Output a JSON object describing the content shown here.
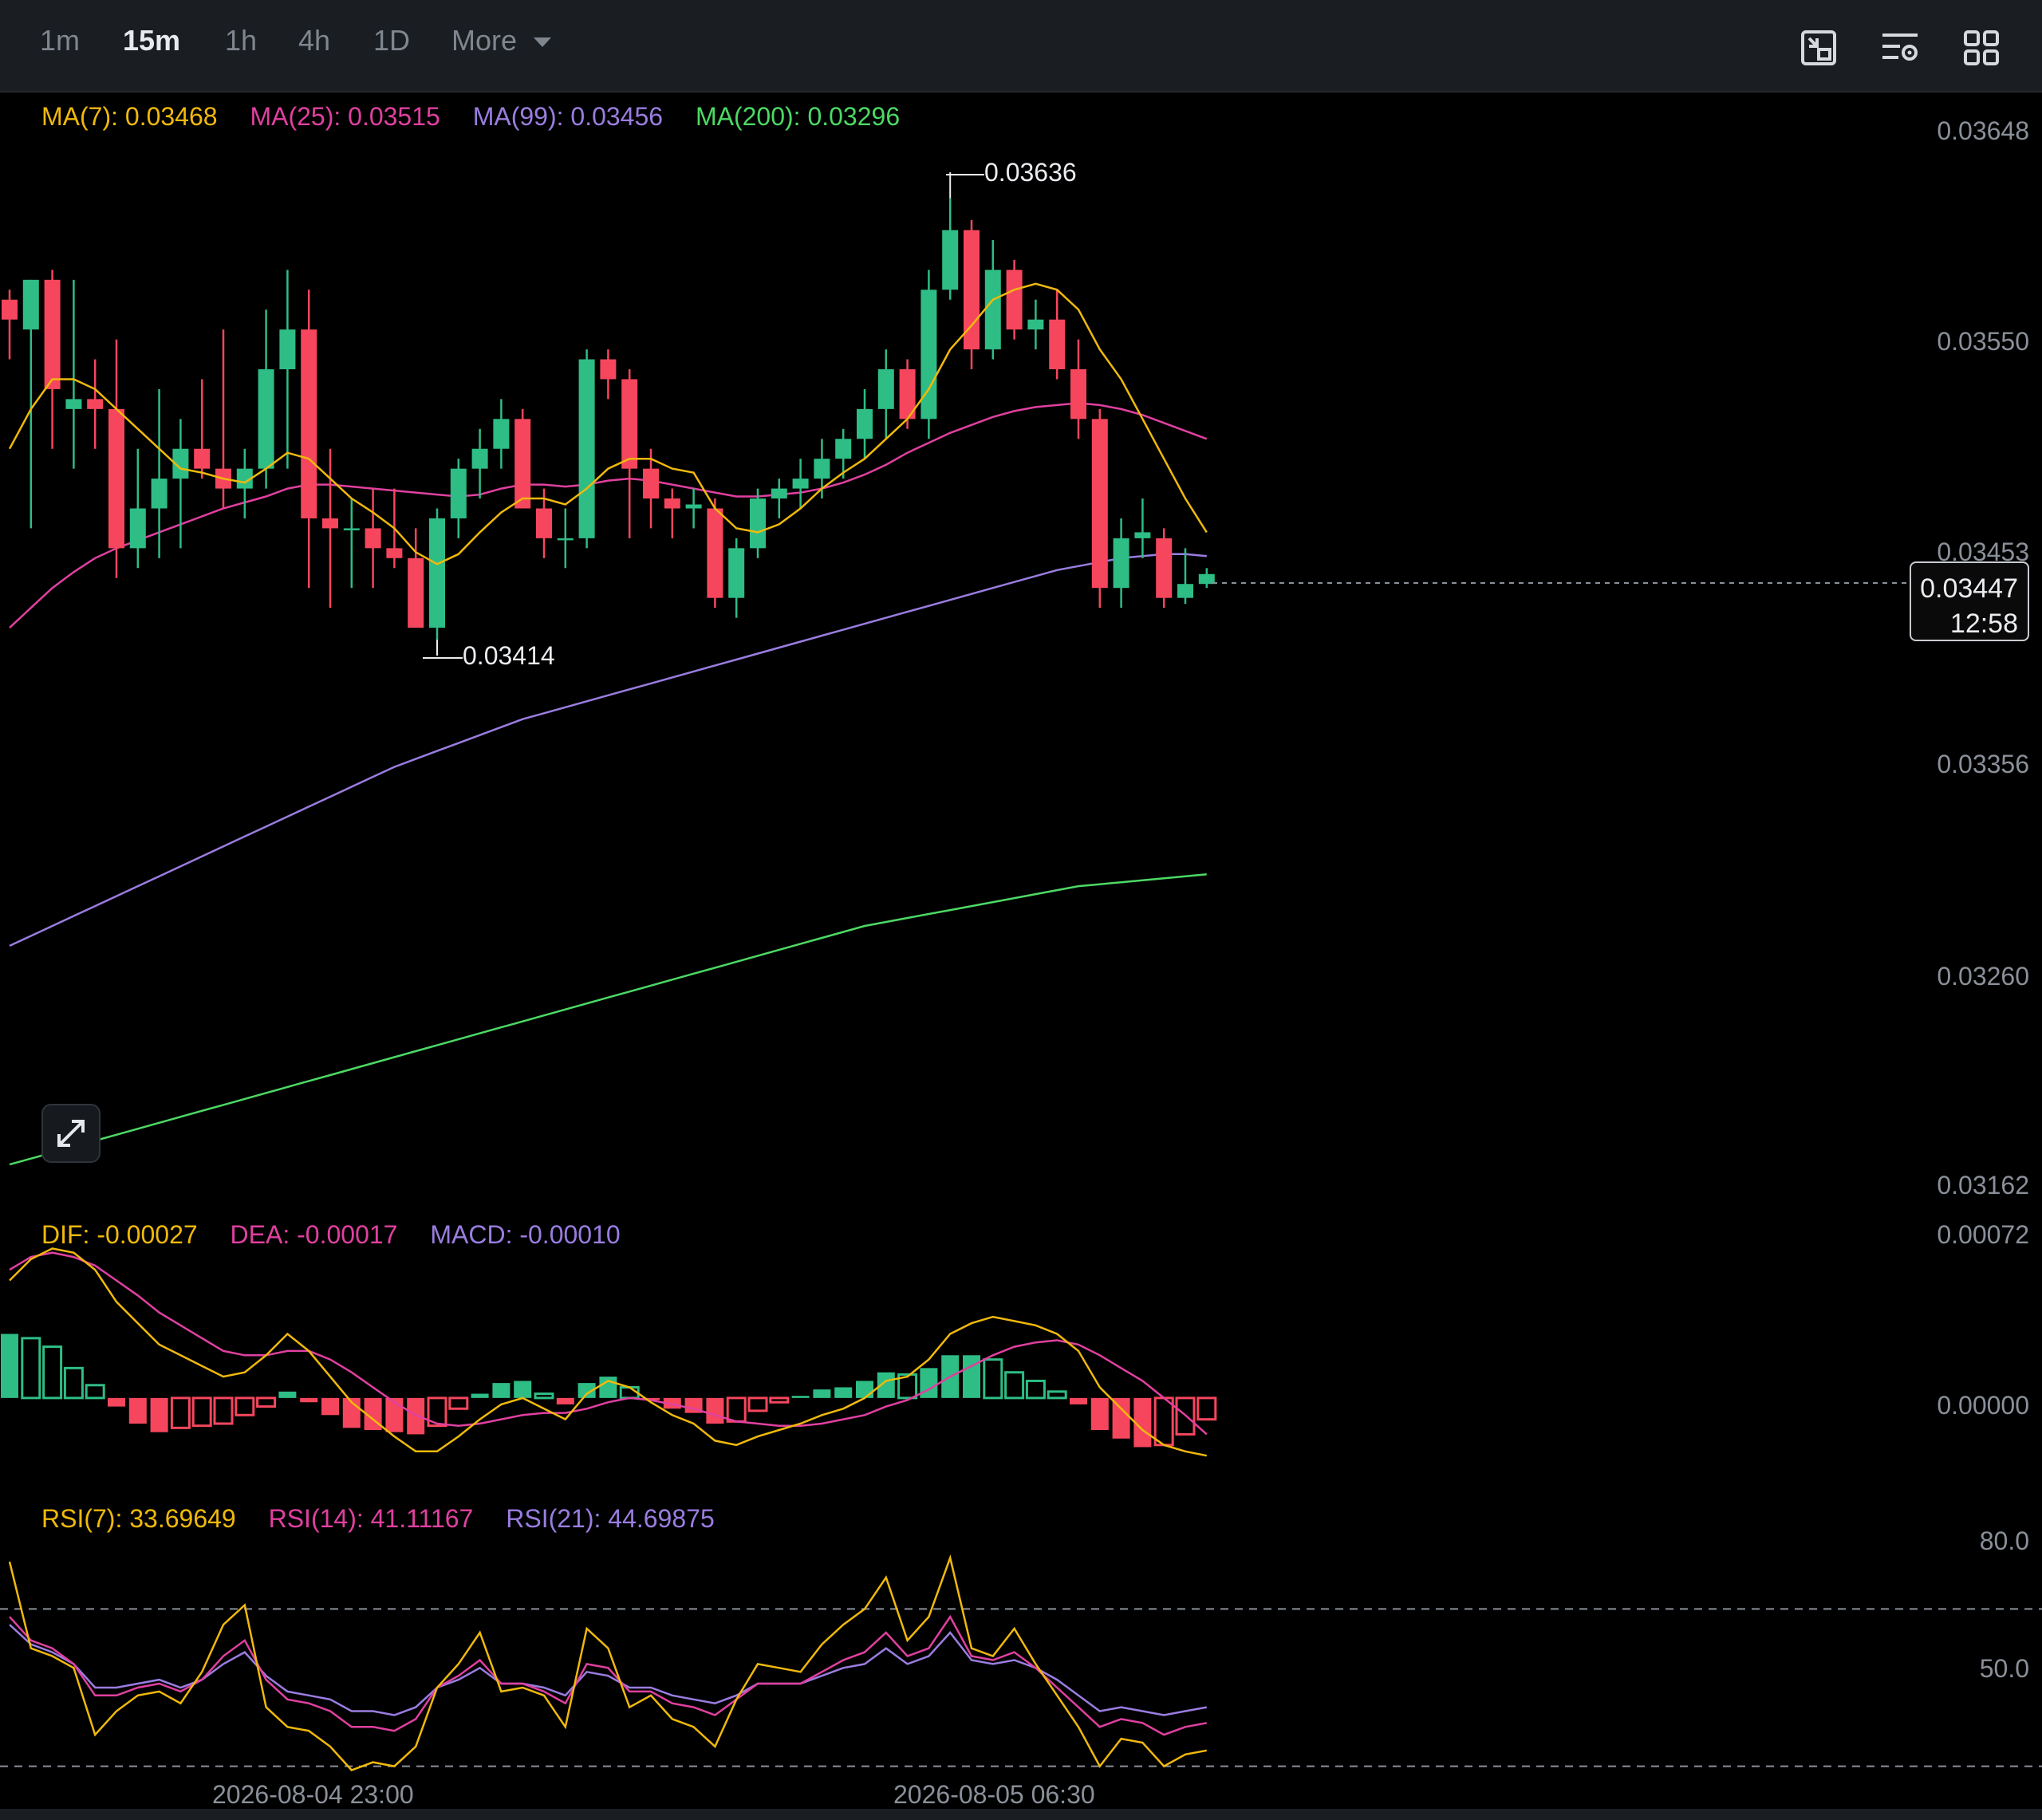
{
  "toolbar": {
    "tabs": [
      {
        "label": "1m",
        "active": false
      },
      {
        "label": "15m",
        "active": true
      },
      {
        "label": "1h",
        "active": false
      },
      {
        "label": "4h",
        "active": false
      },
      {
        "label": "1D",
        "active": false
      },
      {
        "label": "More",
        "active": false
      }
    ],
    "icons": [
      "chart-layout-icon",
      "indicator-settings-icon",
      "grid-icon"
    ]
  },
  "legends": {
    "ma": [
      {
        "label": "MA(7): 0.03468",
        "color": "#f0b90b"
      },
      {
        "label": "MA(25): 0.03515",
        "color": "#e040a0"
      },
      {
        "label": "MA(99): 0.03456",
        "color": "#9a7de0"
      },
      {
        "label": "MA(200): 0.03296",
        "color": "#4cd964"
      }
    ],
    "macd": [
      {
        "label": "DIF: -0.00027",
        "color": "#f0b90b"
      },
      {
        "label": "DEA: -0.00017",
        "color": "#e040a0"
      },
      {
        "label": "MACD: -0.00010",
        "color": "#9a7de0"
      }
    ],
    "rsi": [
      {
        "label": "RSI(7): 33.69649",
        "color": "#f0b90b"
      },
      {
        "label": "RSI(14): 41.11167",
        "color": "#e040a0"
      },
      {
        "label": "RSI(21): 44.69875",
        "color": "#9a7de0"
      }
    ]
  },
  "price_axis": [
    "0.03648",
    "0.03550",
    "0.03453",
    "0.03356",
    "0.03260",
    "0.03162"
  ],
  "macd_axis": [
    "0.00072",
    "0.00000"
  ],
  "rsi_axis": [
    "80.0",
    "50.0"
  ],
  "current_price": {
    "value": "0.03447",
    "countdown": "12:58"
  },
  "annotations": {
    "high": "0.03636",
    "low": "0.03414"
  },
  "time_labels": [
    "2026-08-04 23:00",
    "2026-08-05 06:30"
  ],
  "colors": {
    "up": "#2ebd85",
    "down": "#f6465d",
    "ma7": "#f0b90b",
    "ma25": "#e040a0",
    "ma99": "#9a7de0",
    "ma200": "#4cd964"
  },
  "chart_data": {
    "type": "candlestick",
    "interval": "15m",
    "ylim": [
      0.0313,
      0.0369
    ],
    "candles": [
      {
        "o": 0.03585,
        "h": 0.0359,
        "l": 0.03555,
        "c": 0.03575
      },
      {
        "o": 0.0357,
        "h": 0.03595,
        "l": 0.0347,
        "c": 0.03595
      },
      {
        "o": 0.03595,
        "h": 0.036,
        "l": 0.0351,
        "c": 0.0354
      },
      {
        "o": 0.0353,
        "h": 0.03595,
        "l": 0.035,
        "c": 0.03535
      },
      {
        "o": 0.03535,
        "h": 0.03555,
        "l": 0.0351,
        "c": 0.0353
      },
      {
        "o": 0.0353,
        "h": 0.03565,
        "l": 0.03445,
        "c": 0.0346
      },
      {
        "o": 0.0346,
        "h": 0.0351,
        "l": 0.0345,
        "c": 0.0348
      },
      {
        "o": 0.0348,
        "h": 0.0354,
        "l": 0.03455,
        "c": 0.03495
      },
      {
        "o": 0.03495,
        "h": 0.03525,
        "l": 0.0346,
        "c": 0.0351
      },
      {
        "o": 0.0351,
        "h": 0.03545,
        "l": 0.03495,
        "c": 0.035
      },
      {
        "o": 0.035,
        "h": 0.0357,
        "l": 0.0348,
        "c": 0.0349
      },
      {
        "o": 0.0349,
        "h": 0.0351,
        "l": 0.03475,
        "c": 0.035
      },
      {
        "o": 0.035,
        "h": 0.0358,
        "l": 0.0349,
        "c": 0.0355
      },
      {
        "o": 0.0355,
        "h": 0.036,
        "l": 0.035,
        "c": 0.0357
      },
      {
        "o": 0.0357,
        "h": 0.0359,
        "l": 0.0344,
        "c": 0.03475
      },
      {
        "o": 0.03475,
        "h": 0.0351,
        "l": 0.0343,
        "c": 0.0347
      },
      {
        "o": 0.0347,
        "h": 0.03485,
        "l": 0.0344,
        "c": 0.0347
      },
      {
        "o": 0.0347,
        "h": 0.0349,
        "l": 0.0344,
        "c": 0.0346
      },
      {
        "o": 0.0346,
        "h": 0.0349,
        "l": 0.0345,
        "c": 0.03455
      },
      {
        "o": 0.03455,
        "h": 0.0347,
        "l": 0.0342,
        "c": 0.0342
      },
      {
        "o": 0.0342,
        "h": 0.0348,
        "l": 0.03414,
        "c": 0.03475
      },
      {
        "o": 0.03475,
        "h": 0.03505,
        "l": 0.03465,
        "c": 0.035
      },
      {
        "o": 0.035,
        "h": 0.0352,
        "l": 0.03485,
        "c": 0.0351
      },
      {
        "o": 0.0351,
        "h": 0.03535,
        "l": 0.035,
        "c": 0.03525
      },
      {
        "o": 0.03525,
        "h": 0.0353,
        "l": 0.0348,
        "c": 0.0348
      },
      {
        "o": 0.0348,
        "h": 0.0349,
        "l": 0.03455,
        "c": 0.03465
      },
      {
        "o": 0.03465,
        "h": 0.0348,
        "l": 0.0345,
        "c": 0.03465
      },
      {
        "o": 0.03465,
        "h": 0.0356,
        "l": 0.0346,
        "c": 0.03555
      },
      {
        "o": 0.03555,
        "h": 0.0356,
        "l": 0.03535,
        "c": 0.03545
      },
      {
        "o": 0.03545,
        "h": 0.0355,
        "l": 0.03465,
        "c": 0.035
      },
      {
        "o": 0.035,
        "h": 0.0351,
        "l": 0.0347,
        "c": 0.03485
      },
      {
        "o": 0.03485,
        "h": 0.0349,
        "l": 0.03465,
        "c": 0.0348
      },
      {
        "o": 0.0348,
        "h": 0.0349,
        "l": 0.0347,
        "c": 0.03482
      },
      {
        "o": 0.0348,
        "h": 0.03485,
        "l": 0.0343,
        "c": 0.03435
      },
      {
        "o": 0.03435,
        "h": 0.03465,
        "l": 0.03425,
        "c": 0.0346
      },
      {
        "o": 0.0346,
        "h": 0.0349,
        "l": 0.03455,
        "c": 0.03485
      },
      {
        "o": 0.03485,
        "h": 0.03495,
        "l": 0.03475,
        "c": 0.0349
      },
      {
        "o": 0.0349,
        "h": 0.03505,
        "l": 0.0348,
        "c": 0.03495
      },
      {
        "o": 0.03495,
        "h": 0.03515,
        "l": 0.03485,
        "c": 0.03505
      },
      {
        "o": 0.03505,
        "h": 0.0352,
        "l": 0.03495,
        "c": 0.03515
      },
      {
        "o": 0.03515,
        "h": 0.0354,
        "l": 0.03505,
        "c": 0.0353
      },
      {
        "o": 0.0353,
        "h": 0.0356,
        "l": 0.03515,
        "c": 0.0355
      },
      {
        "o": 0.0355,
        "h": 0.03555,
        "l": 0.0352,
        "c": 0.03525
      },
      {
        "o": 0.03525,
        "h": 0.036,
        "l": 0.03515,
        "c": 0.0359
      },
      {
        "o": 0.0359,
        "h": 0.03636,
        "l": 0.03585,
        "c": 0.0362
      },
      {
        "o": 0.0362,
        "h": 0.03625,
        "l": 0.0355,
        "c": 0.0356
      },
      {
        "o": 0.0356,
        "h": 0.03615,
        "l": 0.03555,
        "c": 0.036
      },
      {
        "o": 0.036,
        "h": 0.03605,
        "l": 0.03565,
        "c": 0.0357
      },
      {
        "o": 0.0357,
        "h": 0.03585,
        "l": 0.0356,
        "c": 0.03575
      },
      {
        "o": 0.03575,
        "h": 0.0359,
        "l": 0.03545,
        "c": 0.0355
      },
      {
        "o": 0.0355,
        "h": 0.03565,
        "l": 0.03515,
        "c": 0.03525
      },
      {
        "o": 0.03525,
        "h": 0.0353,
        "l": 0.0343,
        "c": 0.0344
      },
      {
        "o": 0.0344,
        "h": 0.03475,
        "l": 0.0343,
        "c": 0.03465
      },
      {
        "o": 0.03465,
        "h": 0.03485,
        "l": 0.03455,
        "c": 0.03468
      },
      {
        "o": 0.03465,
        "h": 0.0347,
        "l": 0.0343,
        "c": 0.03435
      },
      {
        "o": 0.03435,
        "h": 0.0346,
        "l": 0.03432,
        "c": 0.03442
      },
      {
        "o": 0.03442,
        "h": 0.0345,
        "l": 0.0344,
        "c": 0.03447
      }
    ],
    "ma7": [
      0.0351,
      0.0353,
      0.03545,
      0.03545,
      0.0354,
      0.0353,
      0.0352,
      0.0351,
      0.035,
      0.03498,
      0.03495,
      0.03493,
      0.035,
      0.03508,
      0.03505,
      0.03495,
      0.03485,
      0.03478,
      0.0347,
      0.03458,
      0.03452,
      0.03457,
      0.03468,
      0.03478,
      0.03485,
      0.03485,
      0.03482,
      0.0349,
      0.035,
      0.03505,
      0.03505,
      0.035,
      0.03498,
      0.0348,
      0.0347,
      0.03468,
      0.03472,
      0.0348,
      0.0349,
      0.03498,
      0.03505,
      0.03515,
      0.03525,
      0.0354,
      0.0356,
      0.03572,
      0.03585,
      0.0359,
      0.03593,
      0.0359,
      0.0358,
      0.0356,
      0.03545,
      0.03525,
      0.03505,
      0.03485,
      0.03468
    ],
    "ma25": [
      0.0342,
      0.0343,
      0.0344,
      0.03448,
      0.03455,
      0.0346,
      0.03464,
      0.03468,
      0.03472,
      0.03476,
      0.0348,
      0.03483,
      0.03486,
      0.0349,
      0.03492,
      0.03492,
      0.03491,
      0.0349,
      0.03489,
      0.03488,
      0.03487,
      0.03486,
      0.03487,
      0.0349,
      0.03492,
      0.03492,
      0.03491,
      0.03492,
      0.03494,
      0.03495,
      0.03494,
      0.03492,
      0.0349,
      0.03488,
      0.03486,
      0.03486,
      0.03487,
      0.03488,
      0.0349,
      0.03493,
      0.03497,
      0.03502,
      0.03508,
      0.03513,
      0.03518,
      0.03522,
      0.03526,
      0.03529,
      0.03531,
      0.03532,
      0.03533,
      0.03532,
      0.0353,
      0.03527,
      0.03523,
      0.03519,
      0.03515
    ],
    "ma99": [
      0.0326,
      0.03265,
      0.0327,
      0.03275,
      0.0328,
      0.03285,
      0.0329,
      0.03295,
      0.033,
      0.03305,
      0.0331,
      0.03315,
      0.0332,
      0.03325,
      0.0333,
      0.03335,
      0.0334,
      0.03345,
      0.0335,
      0.03354,
      0.03358,
      0.03362,
      0.03366,
      0.0337,
      0.03374,
      0.03377,
      0.0338,
      0.03383,
      0.03386,
      0.03389,
      0.03392,
      0.03395,
      0.03398,
      0.03401,
      0.03404,
      0.03407,
      0.0341,
      0.03413,
      0.03416,
      0.03419,
      0.03422,
      0.03425,
      0.03428,
      0.03431,
      0.03434,
      0.03437,
      0.0344,
      0.03443,
      0.03446,
      0.03449,
      0.03451,
      0.03453,
      0.03455,
      0.03456,
      0.03457,
      0.03457,
      0.03456
    ],
    "ma200": [
      0.0315,
      0.03153,
      0.03156,
      0.03159,
      0.03162,
      0.03165,
      0.03168,
      0.03171,
      0.03174,
      0.03177,
      0.0318,
      0.03183,
      0.03186,
      0.03189,
      0.03192,
      0.03195,
      0.03198,
      0.03201,
      0.03204,
      0.03207,
      0.0321,
      0.03213,
      0.03216,
      0.03219,
      0.03222,
      0.03225,
      0.03228,
      0.03231,
      0.03234,
      0.03237,
      0.0324,
      0.03243,
      0.03246,
      0.03249,
      0.03252,
      0.03255,
      0.03258,
      0.03261,
      0.03264,
      0.03267,
      0.0327,
      0.03272,
      0.03274,
      0.03276,
      0.03278,
      0.0328,
      0.03282,
      0.03284,
      0.03286,
      0.03288,
      0.0329,
      0.03291,
      0.03292,
      0.03293,
      0.03294,
      0.03295,
      0.03296
    ],
    "macd_ylim": [
      -0.0004,
      0.00072
    ],
    "dif": [
      0.00055,
      0.00065,
      0.0007,
      0.00068,
      0.0006,
      0.00045,
      0.00035,
      0.00025,
      0.0002,
      0.00015,
      0.0001,
      0.00012,
      0.0002,
      0.0003,
      0.00022,
      0.0001,
      -2e-05,
      -0.0001,
      -0.00018,
      -0.00025,
      -0.00025,
      -0.00018,
      -0.0001,
      -3e-05,
      0.0,
      -5e-05,
      -0.0001,
      2e-05,
      8e-05,
      5e-05,
      -2e-05,
      -8e-05,
      -0.00012,
      -0.0002,
      -0.00022,
      -0.00018,
      -0.00015,
      -0.00012,
      -8e-05,
      -5e-05,
      0.0,
      8e-05,
      0.0001,
      0.00018,
      0.0003,
      0.00035,
      0.00038,
      0.00036,
      0.00034,
      0.0003,
      0.00022,
      5e-05,
      -5e-05,
      -0.00015,
      -0.00022,
      -0.00025,
      -0.00027
    ],
    "dea": [
      0.0006,
      0.00066,
      0.00068,
      0.00066,
      0.00062,
      0.00055,
      0.00048,
      0.0004,
      0.00034,
      0.00028,
      0.00022,
      0.0002,
      0.0002,
      0.00022,
      0.00022,
      0.00018,
      0.00012,
      5e-05,
      -2e-05,
      -8e-05,
      -0.00012,
      -0.00013,
      -0.00012,
      -0.0001,
      -8e-05,
      -7e-05,
      -7e-05,
      -5e-05,
      -2e-05,
      0.0,
      -1e-05,
      -3e-05,
      -5e-05,
      -8e-05,
      -0.00011,
      -0.00012,
      -0.00013,
      -0.00013,
      -0.00012,
      -0.0001,
      -8e-05,
      -4e-05,
      -1e-05,
      4e-05,
      0.0001,
      0.00015,
      0.0002,
      0.00024,
      0.00026,
      0.00027,
      0.00025,
      0.0002,
      0.00014,
      8e-05,
      0.0,
      -8e-05,
      -0.00017
    ],
    "hist": [
      0.0003,
      0.00028,
      0.00024,
      0.00014,
      6e-05,
      -4e-05,
      -0.00012,
      -0.00016,
      -0.00014,
      -0.00013,
      -0.00012,
      -8e-05,
      -4e-05,
      3e-05,
      -2e-05,
      -8e-05,
      -0.00014,
      -0.00015,
      -0.00016,
      -0.00017,
      -0.00013,
      -5e-05,
      2e-05,
      7e-05,
      8e-05,
      2e-05,
      -3e-05,
      7e-05,
      0.0001,
      5e-05,
      -1e-05,
      -5e-05,
      -7e-05,
      -0.00012,
      -0.00011,
      -6e-05,
      -2e-05,
      1e-05,
      4e-05,
      5e-05,
      8e-05,
      0.00012,
      0.00011,
      0.00014,
      0.0002,
      0.0002,
      0.00018,
      0.00012,
      8e-05,
      3e-05,
      -3e-05,
      -0.00015,
      -0.00019,
      -0.00023,
      -0.00022,
      -0.00017,
      -0.0001
    ],
    "rsi_ylim": [
      22,
      93
    ],
    "rsi_bands": [
      70,
      30
    ],
    "rsi7": [
      82,
      60,
      58,
      55,
      38,
      44,
      48,
      49,
      46,
      54,
      66,
      71,
      45,
      40,
      39,
      35,
      29,
      31,
      30,
      35,
      50,
      56,
      64,
      49,
      50,
      48,
      40,
      65,
      60,
      45,
      48,
      42,
      40,
      35,
      47,
      56,
      55,
      54,
      61,
      66,
      70,
      78,
      62,
      68,
      83,
      60,
      58,
      65,
      56,
      48,
      40,
      30,
      37,
      36,
      30,
      33,
      34
    ],
    "rsi14": [
      68,
      62,
      60,
      56,
      48,
      48,
      50,
      51,
      49,
      52,
      58,
      62,
      52,
      47,
      46,
      44,
      40,
      40,
      39,
      42,
      50,
      53,
      57,
      51,
      51,
      49,
      46,
      56,
      55,
      49,
      49,
      46,
      45,
      43,
      47,
      51,
      51,
      51,
      54,
      57,
      59,
      64,
      58,
      60,
      68,
      58,
      57,
      59,
      55,
      50,
      45,
      40,
      42,
      41,
      38,
      40,
      41
    ],
    "rsi21": [
      66,
      61,
      59,
      56,
      50,
      50,
      51,
      52,
      50,
      52,
      56,
      59,
      53,
      49,
      48,
      47,
      44,
      44,
      43,
      45,
      50,
      52,
      55,
      51,
      51,
      50,
      48,
      54,
      53,
      50,
      50,
      48,
      47,
      46,
      48,
      51,
      51,
      51,
      53,
      55,
      56,
      60,
      56,
      58,
      64,
      57,
      56,
      57,
      55,
      52,
      48,
      44,
      45,
      44,
      43,
      44,
      45
    ]
  }
}
